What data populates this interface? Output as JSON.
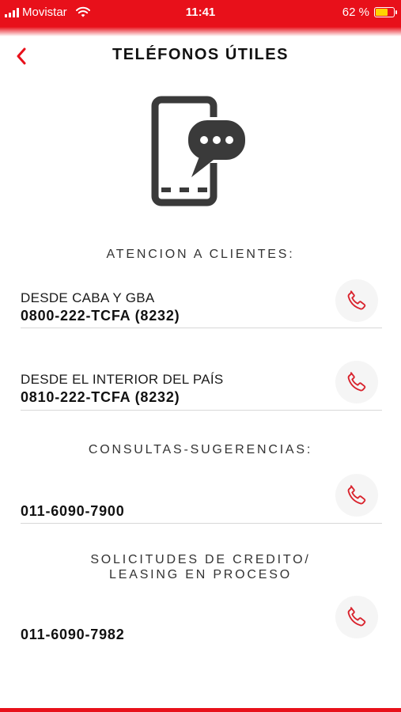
{
  "status_bar": {
    "carrier": "Movistar",
    "time": "11:41",
    "battery_percent": "62 %",
    "battery_level": 0.62,
    "signal_icon": "signal-bars-icon",
    "wifi_icon": "wifi-icon"
  },
  "header": {
    "title": "TELÉFONOS ÚTILES",
    "back_icon": "chevron-left-icon"
  },
  "hero": {
    "icon": "phone-chat-icon"
  },
  "sections": [
    {
      "title": "ATENCION A CLIENTES:",
      "entries": [
        {
          "label": "DESDE CABA Y GBA",
          "number": "0800-222-TCFA (8232)"
        },
        {
          "label": "DESDE EL INTERIOR DEL PAÍS",
          "number": "0810-222-TCFA (8232)"
        }
      ]
    },
    {
      "title": "CONSULTAS-SUGERENCIAS:",
      "entries": [
        {
          "label": "",
          "number": "011-6090-7900"
        }
      ]
    },
    {
      "title_lines": [
        "SOLICITUDES DE CREDITO/",
        "LEASING EN PROCESO"
      ],
      "entries": [
        {
          "label": "",
          "number": "011-6090-7982"
        }
      ]
    }
  ],
  "colors": {
    "brand_red": "#e8101a",
    "phone_icon": "#d9232d",
    "hero_icon": "#3a3a3a"
  },
  "call_icon": "phone-call-icon"
}
